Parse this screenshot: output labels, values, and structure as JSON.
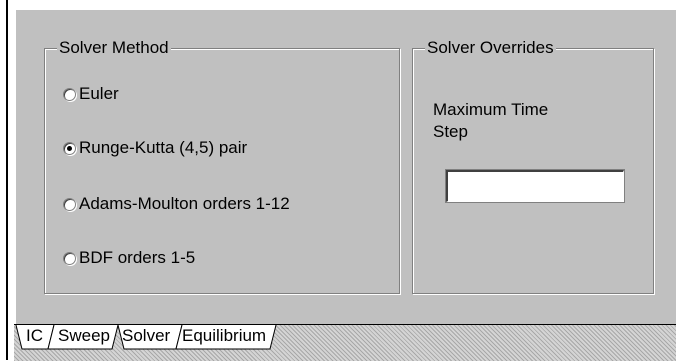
{
  "solver_method": {
    "title": "Solver Method",
    "options": [
      {
        "label": "Euler",
        "checked": false
      },
      {
        "label": "Runge-Kutta (4,5) pair",
        "checked": true
      },
      {
        "label": "Adams-Moulton orders 1-12",
        "checked": false
      },
      {
        "label": "BDF orders 1-5",
        "checked": false
      }
    ]
  },
  "solver_overrides": {
    "title": "Solver Overrides",
    "max_time_step_label_line1": "Maximum Time",
    "max_time_step_label_line2": "Step",
    "max_time_step_value": ""
  },
  "tabs": [
    {
      "label": "IC"
    },
    {
      "label": "Sweep"
    },
    {
      "label": "Solver"
    },
    {
      "label": "Equilibrium"
    }
  ],
  "colors": {
    "face": "#c0c0c0",
    "shadow": "#808080",
    "highlight": "#ffffff"
  }
}
